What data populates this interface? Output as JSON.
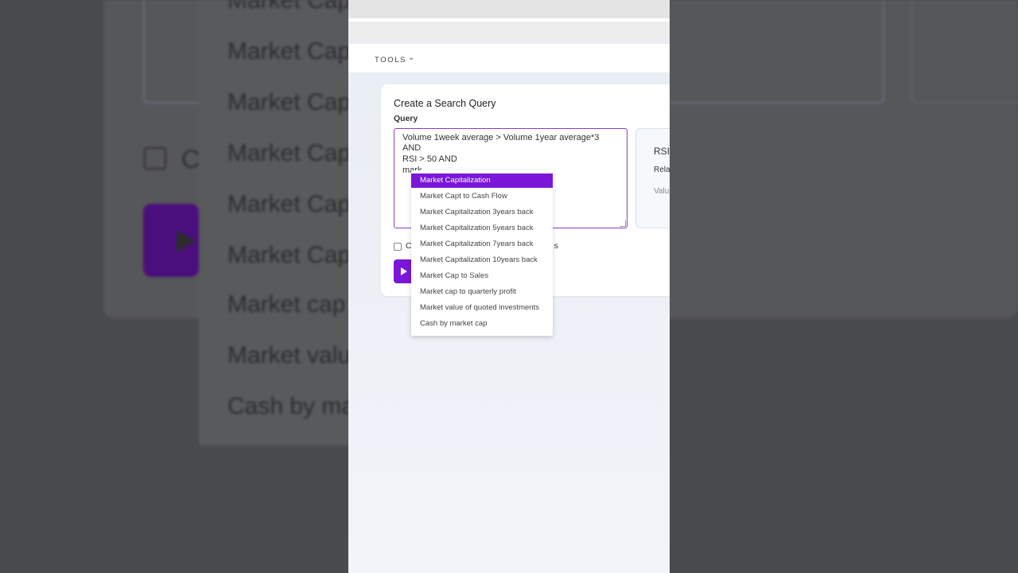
{
  "toolbar": {
    "tools_label": "TOOLS"
  },
  "card": {
    "title": "Create a Search Query",
    "query_label": "Query",
    "query_lines": [
      "Volume 1week average > Volume 1year average*3",
      "AND",
      "RSI > 50 AND",
      "mark"
    ],
    "checkbox_prefix": "C",
    "checkbox_suffix": "s"
  },
  "rsi_panel": {
    "title": "RSI",
    "subtitle": "Rela",
    "value_label": "Valu"
  },
  "autocomplete": {
    "items": [
      "Market Capitalization",
      "Market Capt to Cash Flow",
      "Market Capitalization 3years back",
      "Market Capitalization 5years back",
      "Market Capitalization 7years back",
      "Market Capitalization 10years back",
      "Market Cap to Sales",
      "Market cap to quarterly profit",
      "Market value of quoted investments",
      "Cash by market cap"
    ],
    "selected_index": 0
  },
  "background_blur": {
    "items": [
      "Market Cap",
      "Market Cap",
      "Market Cap",
      "Market Cap",
      "Market Cap",
      "Market Cap",
      "Market cap",
      "Market valu",
      "Cash by ma"
    ],
    "checkbox_text": "C"
  },
  "colors": {
    "accent": "#7a17d8",
    "query_border": "#8b3bc9"
  }
}
